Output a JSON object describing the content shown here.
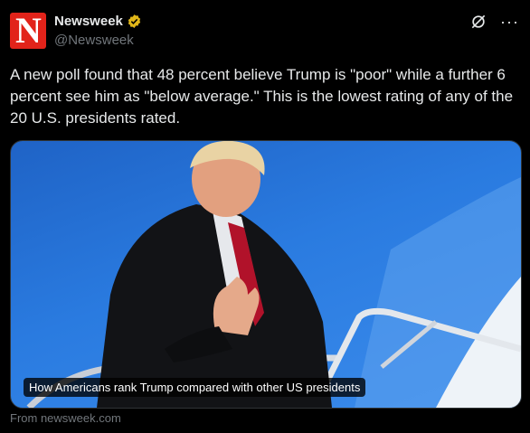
{
  "author": {
    "display_name": "Newsweek",
    "handle": "@Newsweek",
    "avatar_letter": "N",
    "avatar_color": "#e2231a",
    "verified_color": "#e2b719"
  },
  "actions": {
    "grok_icon": "grok-icon",
    "more_label": "···"
  },
  "tweet": {
    "text": "A new poll found that 48 percent believe Trump is \"poor\" while a further 6 percent see him as \"below average.\" This is the lowest rating of any of the 20 U.S. presidents rated."
  },
  "card": {
    "caption": "How Americans rank Trump compared with other US presidents",
    "source": "From newsweek.com"
  },
  "colors": {
    "background": "#000000",
    "text": "#e7e9ea",
    "secondary": "#71767b",
    "sky": "#2a7be0"
  }
}
